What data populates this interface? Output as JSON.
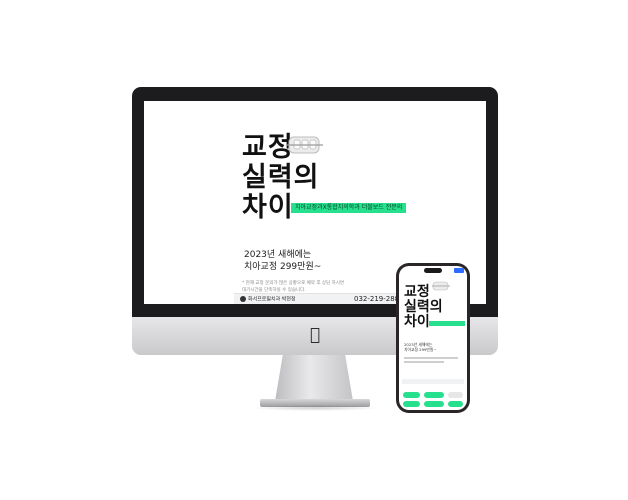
{
  "desktop": {
    "headline_lines": [
      "교정",
      "실력의",
      "차이"
    ],
    "tag": "치아교정과X통합치의학과 더블보드 전문의",
    "promo_lines": [
      "2023년 새해에는",
      "치아교정 299만원~"
    ],
    "note_lines": [
      "* 현재 교정 문의가 많은 상황으로 예약 후 상담 하시면",
      "  대기시간을 단축하실 수 있습니다."
    ],
    "clinic_name": "화서프로필치과 박현정",
    "phone_number": "032-219-2880"
  },
  "phone": {
    "headline_lines": [
      "교정",
      "실력의",
      "차이"
    ],
    "promo_lines": [
      "2023년 새해에는",
      "치아교정 299만원~"
    ]
  },
  "colors": {
    "accent_green": "#27e08d",
    "bezel": "#1c1c1e",
    "phone_frame": "#2a2528"
  },
  "icons": {
    "apple_logo": "apple-logo-icon",
    "braces_image": "braces-image"
  }
}
